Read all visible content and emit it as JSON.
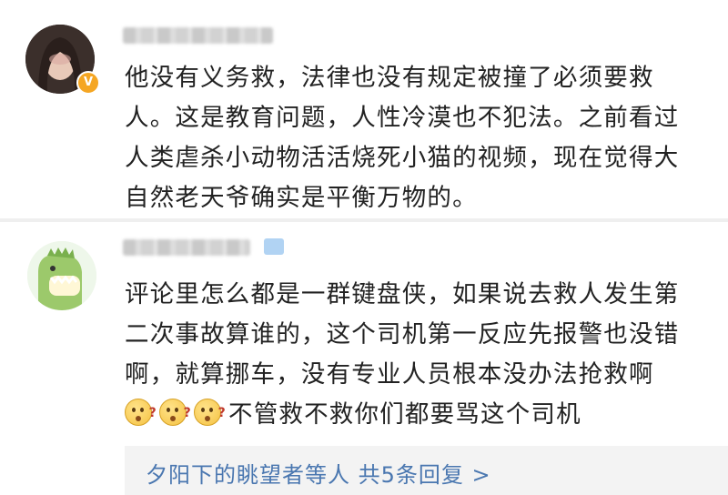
{
  "comments": [
    {
      "verified_badge": "V",
      "text_lines": [
        "他没有义务救，法律也没有规定被撞了必须要救",
        "人。这是教育问题，人性冷漠也不犯法。之前看过",
        "人类虐杀小动物活活烧死小猫的视频，现在觉得大",
        "自然老天爷确实是平衡万物的。"
      ]
    },
    {
      "text_lines": [
        "评论里怎么都是一群键盘侠，如果说去救人发生第",
        "二次事故算谁的，这个司机第一反应先报警也没错",
        "啊，就算挪车，没有专业人员根本没办法抢救啊"
      ],
      "emoji_count": 3,
      "emoji_name": "confused-face-icon",
      "emoji_mark": "?",
      "text_after_emoji": "不管救不救你们都要骂这个司机",
      "reply_summary": "夕阳下的眺望者等人 共5条回复 >"
    }
  ]
}
